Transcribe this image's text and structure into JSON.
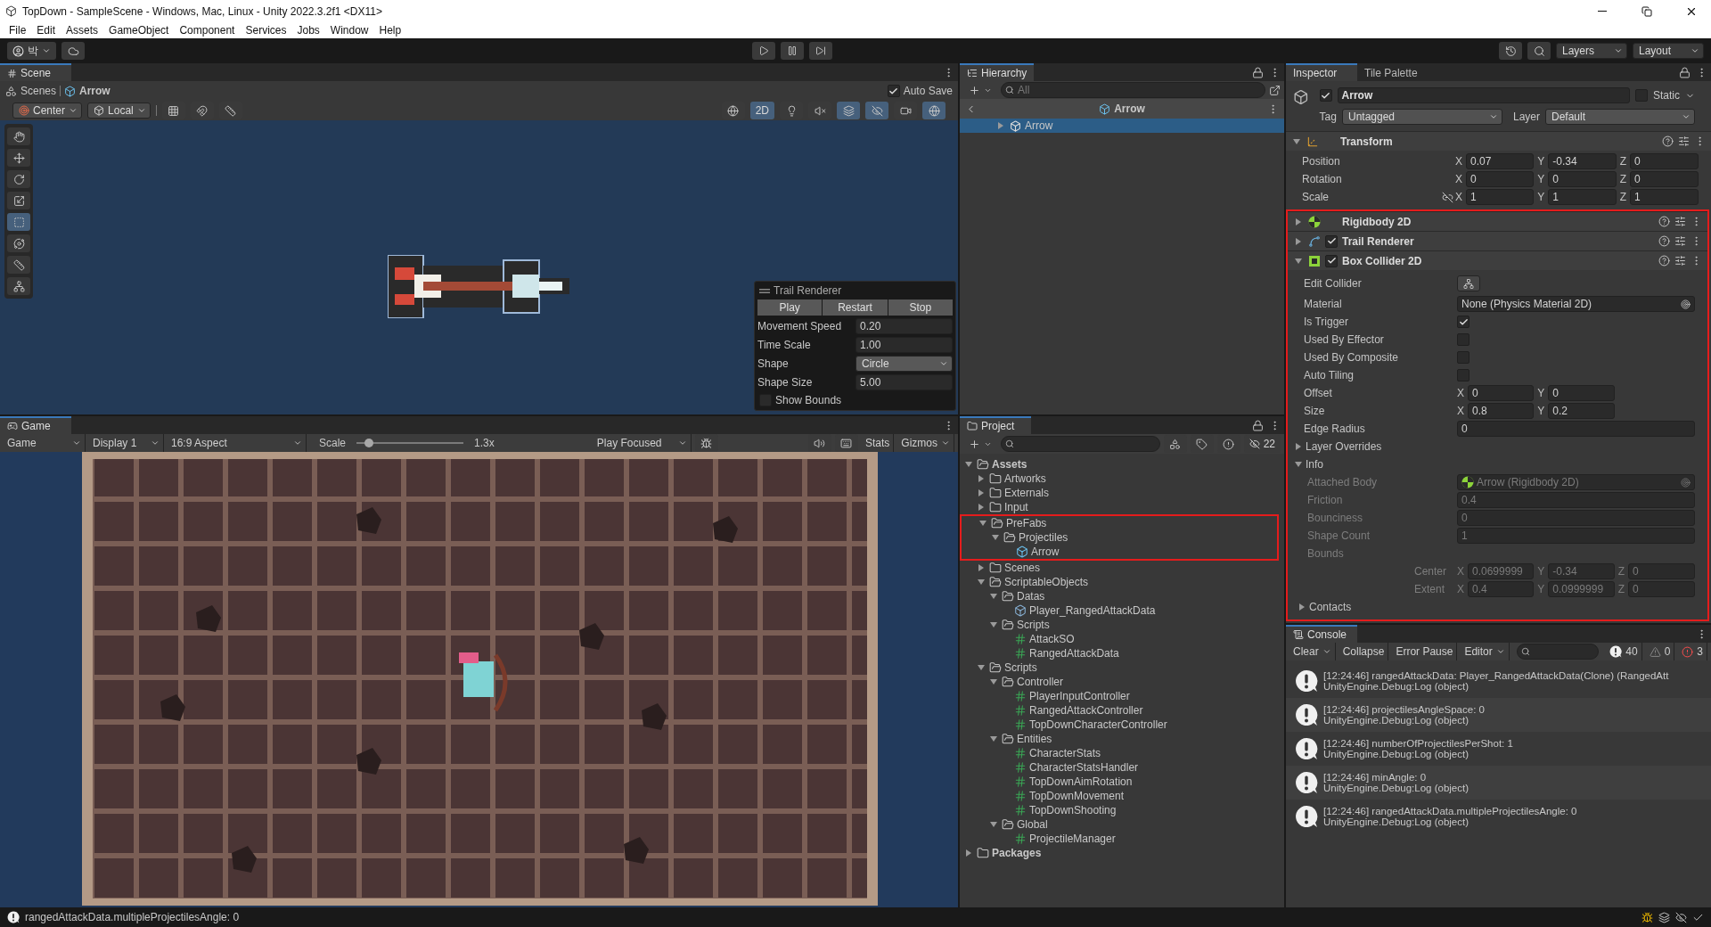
{
  "window": {
    "title": "TopDown - SampleScene - Windows, Mac, Linux - Unity 2022.3.2f1 <DX11>"
  },
  "menu": [
    "File",
    "Edit",
    "Assets",
    "GameObject",
    "Component",
    "Services",
    "Jobs",
    "Window",
    "Help"
  ],
  "toolbar": {
    "account": "박",
    "layers": "Layers",
    "layout": "Layout"
  },
  "scene": {
    "tab": "Scene",
    "breadcrumb": [
      "Scenes",
      "Arrow"
    ],
    "auto_save": {
      "label": "Auto Save",
      "checked": true
    },
    "pivot": "Center",
    "space": "Local",
    "mode_2d": {
      "label": "2D",
      "selected": true
    },
    "trail_overlay": {
      "title": "Trail Renderer",
      "buttons": [
        "Play",
        "Restart",
        "Stop"
      ],
      "fields": [
        {
          "kind": "number",
          "label": "Movement Speed",
          "value": "0.20"
        },
        {
          "kind": "number",
          "label": "Time Scale",
          "value": "1.00"
        },
        {
          "kind": "dropdown",
          "label": "Shape",
          "value": "Circle"
        },
        {
          "kind": "number",
          "label": "Shape Size",
          "value": "5.00"
        }
      ],
      "show_bounds": {
        "label": "Show Bounds",
        "checked": false
      }
    }
  },
  "game": {
    "tab": "Game",
    "view": "Game",
    "display": "Display 1",
    "aspect": "16:9 Aspect",
    "scale_label": "Scale",
    "scale": {
      "level": 0.12
    },
    "scale_reading": "1.3x",
    "play_focused": "Play Focused",
    "stats": "Stats",
    "gizmos": "Gizmos"
  },
  "hierarchy": {
    "tab": "Hierarchy",
    "search_placeholder": "All",
    "header": "Arrow",
    "items": [
      {
        "label": "Arrow",
        "selected": true
      }
    ]
  },
  "project": {
    "tab": "Project",
    "hidden_count": "22",
    "tree": [
      {
        "label": "Assets",
        "kind": "folder",
        "expanded": true,
        "children": [
          {
            "label": "Artworks",
            "kind": "folder",
            "expanded": false
          },
          {
            "label": "Externals",
            "kind": "folder",
            "expanded": false
          },
          {
            "label": "Input",
            "kind": "folder",
            "expanded": false
          },
          {
            "label": "PreFabs",
            "kind": "folder",
            "expanded": true,
            "highlighted": true,
            "children": [
              {
                "label": "Projectiles",
                "kind": "folder",
                "expanded": true,
                "children": [
                  {
                    "label": "Arrow",
                    "kind": "prefab"
                  }
                ]
              }
            ]
          },
          {
            "label": "Scenes",
            "kind": "folder",
            "expanded": false
          },
          {
            "label": "ScriptableObjects",
            "kind": "folder",
            "expanded": true,
            "children": [
              {
                "label": "Datas",
                "kind": "folder",
                "expanded": true,
                "children": [
                  {
                    "label": "Player_RangedAttackData",
                    "kind": "asset"
                  }
                ]
              },
              {
                "label": "Scripts",
                "kind": "folder",
                "expanded": true,
                "children": [
                  {
                    "label": "AttackSO",
                    "kind": "script"
                  },
                  {
                    "label": "RangedAttackData",
                    "kind": "script"
                  }
                ]
              }
            ]
          },
          {
            "label": "Scripts",
            "kind": "folder",
            "expanded": true,
            "children": [
              {
                "label": "Controller",
                "kind": "folder",
                "expanded": true,
                "children": [
                  {
                    "label": "PlayerInputController",
                    "kind": "script"
                  },
                  {
                    "label": "RangedAttackController",
                    "kind": "script"
                  },
                  {
                    "label": "TopDownCharacterController",
                    "kind": "script"
                  }
                ]
              },
              {
                "label": "Entities",
                "kind": "folder",
                "expanded": true,
                "children": [
                  {
                    "label": "CharacterStats",
                    "kind": "script"
                  },
                  {
                    "label": "CharacterStatsHandler",
                    "kind": "script"
                  },
                  {
                    "label": "TopDownAimRotation",
                    "kind": "script"
                  },
                  {
                    "label": "TopDownMovement",
                    "kind": "script"
                  },
                  {
                    "label": "TopDownShooting",
                    "kind": "script"
                  }
                ]
              },
              {
                "label": "Global",
                "kind": "folder",
                "expanded": true,
                "children": [
                  {
                    "label": "ProjectileManager",
                    "kind": "script"
                  }
                ]
              }
            ]
          }
        ]
      },
      {
        "label": "Packages",
        "kind": "folder",
        "expanded": false
      }
    ]
  },
  "inspector": {
    "tabs": [
      {
        "label": "Inspector",
        "selected": true
      },
      {
        "label": "Tile Palette",
        "selected": false
      }
    ],
    "object": {
      "name": "Arrow",
      "active": true,
      "static_label": "Static",
      "static": false,
      "tag_label": "Tag",
      "tag": "Untagged",
      "layer_label": "Layer",
      "layer": "Default"
    },
    "components": [
      {
        "kind": "transform",
        "title": "Transform",
        "expanded": true,
        "rows": [
          {
            "kind": "vector",
            "label": "Position",
            "values": [
              {
                "axis": "X",
                "value": "0.07"
              },
              {
                "axis": "Y",
                "value": "-0.34"
              },
              {
                "axis": "Z",
                "value": "0"
              }
            ]
          },
          {
            "kind": "vector",
            "label": "Rotation",
            "values": [
              {
                "axis": "X",
                "value": "0"
              },
              {
                "axis": "Y",
                "value": "0"
              },
              {
                "axis": "Z",
                "value": "0"
              }
            ]
          },
          {
            "kind": "vector",
            "label": "Scale",
            "locked": false,
            "values": [
              {
                "axis": "X",
                "value": "1"
              },
              {
                "axis": "Y",
                "value": "1"
              },
              {
                "axis": "Z",
                "value": "1"
              }
            ]
          }
        ]
      },
      {
        "kind": "rigidbody",
        "title": "Rigidbody 2D",
        "expanded": false,
        "highlighted": true
      },
      {
        "kind": "trail",
        "title": "Trail Renderer",
        "expanded": false,
        "enabled": true,
        "highlighted": true
      },
      {
        "kind": "box_collider",
        "title": "Box Collider 2D",
        "expanded": true,
        "enabled": true,
        "highlighted": true,
        "rows": [
          {
            "kind": "button",
            "label": "Edit Collider"
          },
          {
            "kind": "object",
            "label": "Material",
            "value": "None (Physics Material 2D)"
          },
          {
            "kind": "checkbox",
            "label": "Is Trigger",
            "checked": true
          },
          {
            "kind": "checkbox",
            "label": "Used By Effector",
            "checked": false
          },
          {
            "kind": "checkbox",
            "label": "Used By Composite",
            "checked": false
          },
          {
            "kind": "checkbox",
            "label": "Auto Tiling",
            "checked": false
          },
          {
            "kind": "vector",
            "label": "Offset",
            "values": [
              {
                "axis": "X",
                "value": "0"
              },
              {
                "axis": "Y",
                "value": "0"
              }
            ]
          },
          {
            "kind": "vector",
            "label": "Size",
            "values": [
              {
                "axis": "X",
                "value": "0.8"
              },
              {
                "axis": "Y",
                "value": "0.2"
              }
            ]
          },
          {
            "kind": "float",
            "label": "Edge Radius",
            "value": "0"
          },
          {
            "kind": "foldout",
            "label": "Layer Overrides",
            "expanded": false
          },
          {
            "kind": "foldout",
            "label": "Info",
            "expanded": true,
            "children": [
              {
                "kind": "component_ref",
                "label": "Attached Body",
                "value": "Arrow (Rigidbody 2D)",
                "disabled": true
              },
              {
                "kind": "float",
                "label": "Friction",
                "value": "0.4",
                "disabled": true
              },
              {
                "kind": "float",
                "label": "Bounciness",
                "value": "0",
                "disabled": true
              },
              {
                "kind": "float",
                "label": "Shape Count",
                "value": "1",
                "disabled": true
              },
              {
                "kind": "group",
                "label": "Bounds",
                "disabled": true,
                "children": [
                  {
                    "kind": "vector",
                    "label": "Center",
                    "values": [
                      {
                        "axis": "X",
                        "value": "0.0699999"
                      },
                      {
                        "axis": "Y",
                        "value": "-0.34"
                      },
                      {
                        "axis": "Z",
                        "value": "0"
                      }
                    ]
                  },
                  {
                    "kind": "vector",
                    "label": "Extent",
                    "values": [
                      {
                        "axis": "X",
                        "value": "0.4"
                      },
                      {
                        "axis": "Y",
                        "value": "0.0999999"
                      },
                      {
                        "axis": "Z",
                        "value": "0"
                      }
                    ]
                  }
                ]
              },
              {
                "kind": "foldout",
                "label": "Contacts",
                "expanded": false,
                "disabled": false
              }
            ]
          }
        ]
      }
    ]
  },
  "console": {
    "tab": "Console",
    "buttons": [
      "Clear",
      "Collapse",
      "Error Pause",
      "Editor"
    ],
    "counts": {
      "log": "40",
      "warning": "0",
      "error": "3"
    },
    "entries": [
      {
        "message": "[12:24:46] rangedAttackData: Player_RangedAttackData(Clone) (RangedAtt",
        "trace": "UnityEngine.Debug:Log (object)"
      },
      {
        "message": "[12:24:46] projectilesAngleSpace: 0",
        "trace": "UnityEngine.Debug:Log (object)"
      },
      {
        "message": "[12:24:46] numberOfProjectilesPerShot: 1",
        "trace": "UnityEngine.Debug:Log (object)"
      },
      {
        "message": "[12:24:46] minAngle: 0",
        "trace": "UnityEngine.Debug:Log (object)"
      },
      {
        "message": "[12:24:46] rangedAttackData.multipleProjectilesAngle: 0",
        "trace": "UnityEngine.Debug:Log (object)"
      }
    ]
  },
  "status_bar": {
    "message": "rangedAttackData.multipleProjectilesAngle: 0"
  }
}
